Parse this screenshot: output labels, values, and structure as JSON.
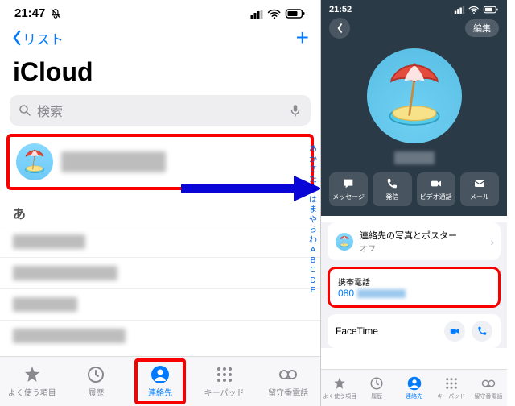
{
  "left": {
    "time": "21:47",
    "back_label": "リスト",
    "title": "iCloud",
    "search_placeholder": "検索",
    "section_letter": "あ",
    "index_chars": [
      "あ",
      "か",
      "さ",
      "た",
      "な",
      "は",
      "ま",
      "や",
      "ら",
      "わ",
      "A",
      "B",
      "C",
      "D",
      "E"
    ],
    "tabs": [
      {
        "label": "よく使う項目",
        "icon": "star-icon"
      },
      {
        "label": "履歴",
        "icon": "clock-icon"
      },
      {
        "label": "連絡先",
        "icon": "person-icon",
        "active": true,
        "highlight": true
      },
      {
        "label": "キーパッド",
        "icon": "keypad-icon"
      },
      {
        "label": "留守番電話",
        "icon": "voicemail-icon"
      }
    ]
  },
  "right": {
    "time": "21:52",
    "edit_label": "編集",
    "actions": [
      {
        "label": "メッセージ",
        "icon": "message-icon"
      },
      {
        "label": "発信",
        "icon": "phone-icon"
      },
      {
        "label": "ビデオ通話",
        "icon": "video-icon"
      },
      {
        "label": "メール",
        "icon": "mail-icon"
      }
    ],
    "photo_cell": {
      "title": "連絡先の写真とポスター",
      "sub": "オフ"
    },
    "phone_cell": {
      "label": "携帯電話",
      "value": "080"
    },
    "facetime_label": "FaceTime",
    "tabs": [
      {
        "label": "よく使う項目",
        "icon": "star-icon"
      },
      {
        "label": "履歴",
        "icon": "clock-icon"
      },
      {
        "label": "連絡先",
        "icon": "person-icon",
        "active": true
      },
      {
        "label": "キーパッド",
        "icon": "keypad-icon"
      },
      {
        "label": "留守番電話",
        "icon": "voicemail-icon"
      }
    ]
  }
}
